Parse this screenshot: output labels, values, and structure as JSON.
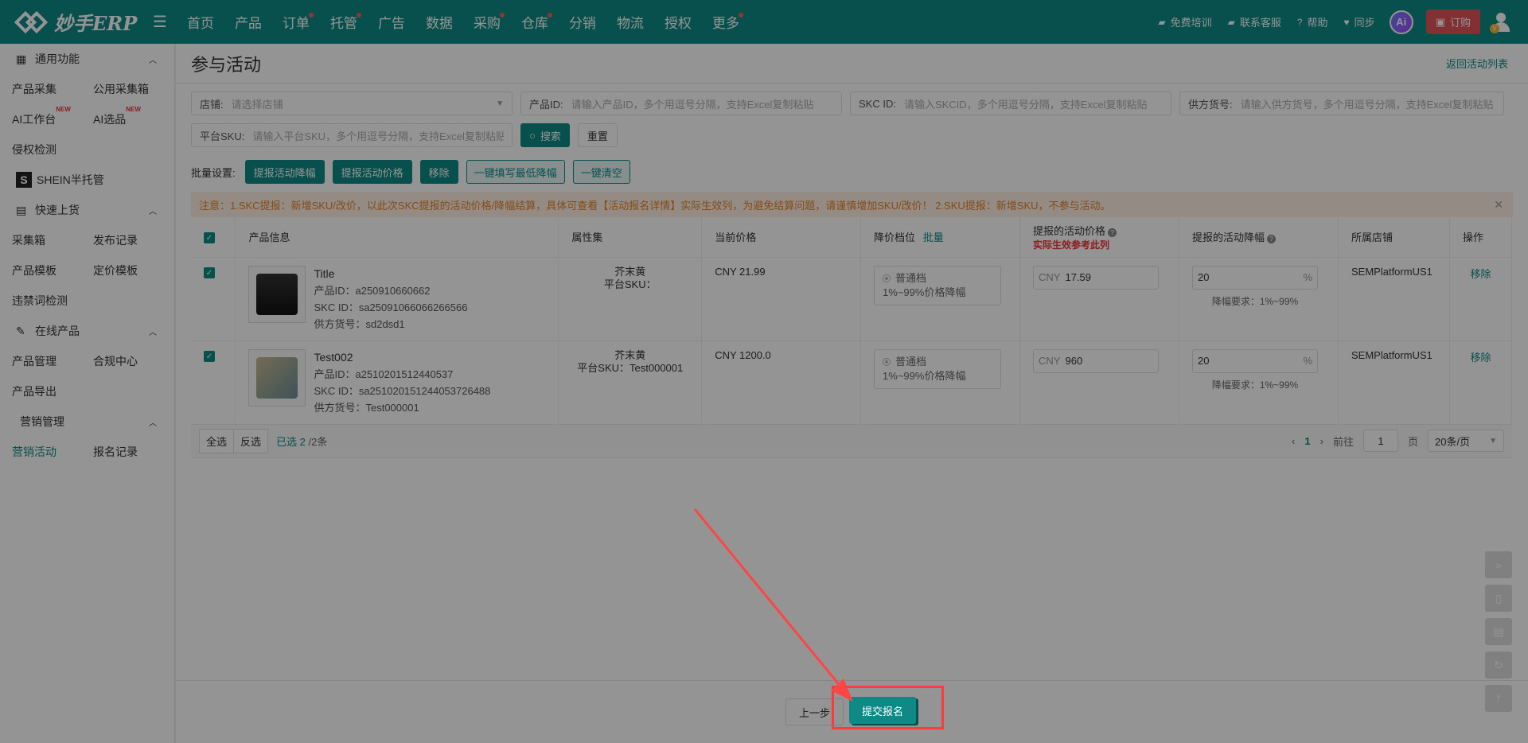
{
  "app": {
    "logo_text": "妙手ERP",
    "nav": [
      {
        "label": "首页",
        "dot": false
      },
      {
        "label": "产品",
        "dot": false
      },
      {
        "label": "订单",
        "dot": true
      },
      {
        "label": "托管",
        "dot": true
      },
      {
        "label": "广告",
        "dot": false
      },
      {
        "label": "数据",
        "dot": false
      },
      {
        "label": "采购",
        "dot": true
      },
      {
        "label": "仓库",
        "dot": true
      },
      {
        "label": "分销",
        "dot": false
      },
      {
        "label": "物流",
        "dot": false
      },
      {
        "label": "授权",
        "dot": false
      },
      {
        "label": "更多",
        "dot": true
      }
    ],
    "top_right": {
      "training": "免费培训",
      "support": "联系客服",
      "help": "帮助",
      "sync": "同步",
      "ai": "Ai",
      "order": "订购",
      "vip": "V"
    },
    "accent_color": "#0d8a86"
  },
  "sidebar": {
    "general": {
      "title": "通用功能",
      "items": [
        "产品采集",
        "公用采集箱",
        "AI工作台",
        "AI选品",
        "侵权检测"
      ],
      "new_tag": "NEW"
    },
    "shein": {
      "badge": "S",
      "title": "SHEIN半托管"
    },
    "quick_upload": {
      "title": "快速上货",
      "items": [
        "采集箱",
        "发布记录",
        "产品模板",
        "定价模板",
        "违禁词检测"
      ]
    },
    "online": {
      "title": "在线产品",
      "items": [
        "产品管理",
        "合规中心",
        "产品导出"
      ]
    },
    "marketing": {
      "title": "营销管理",
      "items": [
        "营销活动",
        "报名记录"
      ]
    }
  },
  "page": {
    "title": "参与活动",
    "back_link": "返回活动列表"
  },
  "filters": {
    "store": {
      "label": "店铺:",
      "placeholder": "请选择店铺"
    },
    "product_id": {
      "label": "产品ID:",
      "placeholder": "请输入产品ID，多个用逗号分隔，支持Excel复制粘贴"
    },
    "skc_id": {
      "label": "SKC ID:",
      "placeholder": "请输入SKCID，多个用逗号分隔，支持Excel复制粘贴"
    },
    "supplier_no": {
      "label": "供方货号:",
      "placeholder": "请输入供方货号，多个用逗号分隔，支持Excel复制粘贴"
    },
    "platform_sku": {
      "label": "平台SKU:",
      "placeholder": "请输入平台SKU，多个用逗号分隔，支持Excel复制粘贴"
    },
    "search_btn": "搜索",
    "reset_btn": "重置"
  },
  "batch": {
    "label": "批量设置:",
    "btn_discount": "提报活动降幅",
    "btn_price": "提报活动价格",
    "btn_remove": "移除",
    "btn_fill_min": "一键填写最低降幅",
    "btn_clear": "一键清空"
  },
  "notice": {
    "text": "注意：1.SKC提报：新增SKU/改价，以此次SKC提报的活动价格/降幅结算，具体可查看【活动报名详情】实际生效列，为避免结算问题，请谨慎增加SKU/改价！ 2.SKU提报：新增SKU，不参与活动。"
  },
  "table": {
    "headers": {
      "product": "产品信息",
      "attr": "属性集",
      "price": "当前价格",
      "tier": "降价档位",
      "tier_batch": "批量",
      "activity_price": "提报的活动价格",
      "activity_price_note": "实际生效参考此列",
      "activity_discount": "提报的活动降幅",
      "store": "所属店铺",
      "action": "操作"
    },
    "rows": [
      {
        "title": "Title",
        "product_id": "产品ID：a250910660662",
        "skc_id": "SKC ID：sa25091066066266566",
        "supplier_no": "供方货号：sd2dsd1",
        "attr_color": "芥末黄",
        "attr_sku": "平台SKU：",
        "price": "CNY 21.99",
        "tier_name": "普通档",
        "tier_range": "1%~99%价格降幅",
        "act_currency": "CNY",
        "act_price": "17.59",
        "discount": "20",
        "discount_unit": "%",
        "discount_hint": "降幅要求：1%~99%",
        "store": "SEMPlatformUS1",
        "action": "移除"
      },
      {
        "title": "Test002",
        "product_id": "产品ID：a2510201512440537",
        "skc_id": "SKC ID：sa2510201512440537264​88",
        "supplier_no": "供方货号：Test000001",
        "attr_color": "芥末黄",
        "attr_sku": "平台SKU：Test000001",
        "price": "CNY 1200.0",
        "tier_name": "普通档",
        "tier_range": "1%~99%价格降幅",
        "act_currency": "CNY",
        "act_price": "960",
        "discount": "20",
        "discount_unit": "%",
        "discount_hint": "降幅要求：1%~99%",
        "store": "SEMPlatformUS1",
        "action": "移除"
      }
    ]
  },
  "pager": {
    "select_all": "全选",
    "invert": "反选",
    "selected": "已选 2",
    "total": "/2条",
    "current_page": "1",
    "goto_label": "前往",
    "goto_value": "1",
    "page_unit": "页",
    "page_size": "20条/页"
  },
  "footer": {
    "prev": "上一步",
    "submit": "提交报名"
  }
}
